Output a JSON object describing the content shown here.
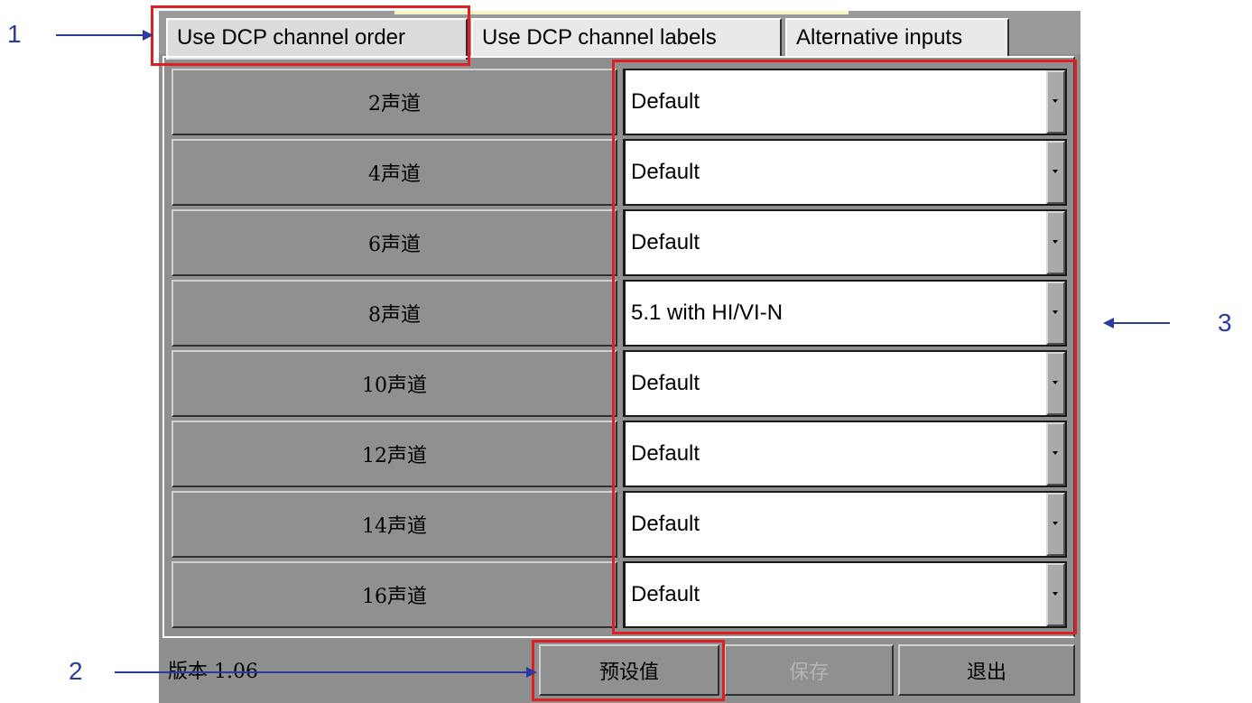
{
  "tabs": [
    {
      "label": "Use DCP channel order"
    },
    {
      "label": "Use DCP channel labels"
    },
    {
      "label": "Alternative inputs"
    }
  ],
  "rows": [
    {
      "label": "2声道",
      "value": "Default"
    },
    {
      "label": "4声道",
      "value": "Default"
    },
    {
      "label": "6声道",
      "value": "Default"
    },
    {
      "label": "8声道",
      "value": "5.1 with HI/VI-N"
    },
    {
      "label": "10声道",
      "value": "Default"
    },
    {
      "label": "12声道",
      "value": "Default"
    },
    {
      "label": "14声道",
      "value": "Default"
    },
    {
      "label": "16声道",
      "value": "Default"
    }
  ],
  "footer": {
    "version": "版本 1.06",
    "preset_label": "预设值",
    "save_label": "保存",
    "exit_label": "退出"
  },
  "annotations": {
    "n1": "1",
    "n2": "2",
    "n3": "3"
  },
  "colors": {
    "highlight": "#e02020",
    "annotation": "#2a3a9e",
    "panel": "#8f8f8f"
  },
  "icons": {
    "dropdown": "chevron-down-icon"
  }
}
